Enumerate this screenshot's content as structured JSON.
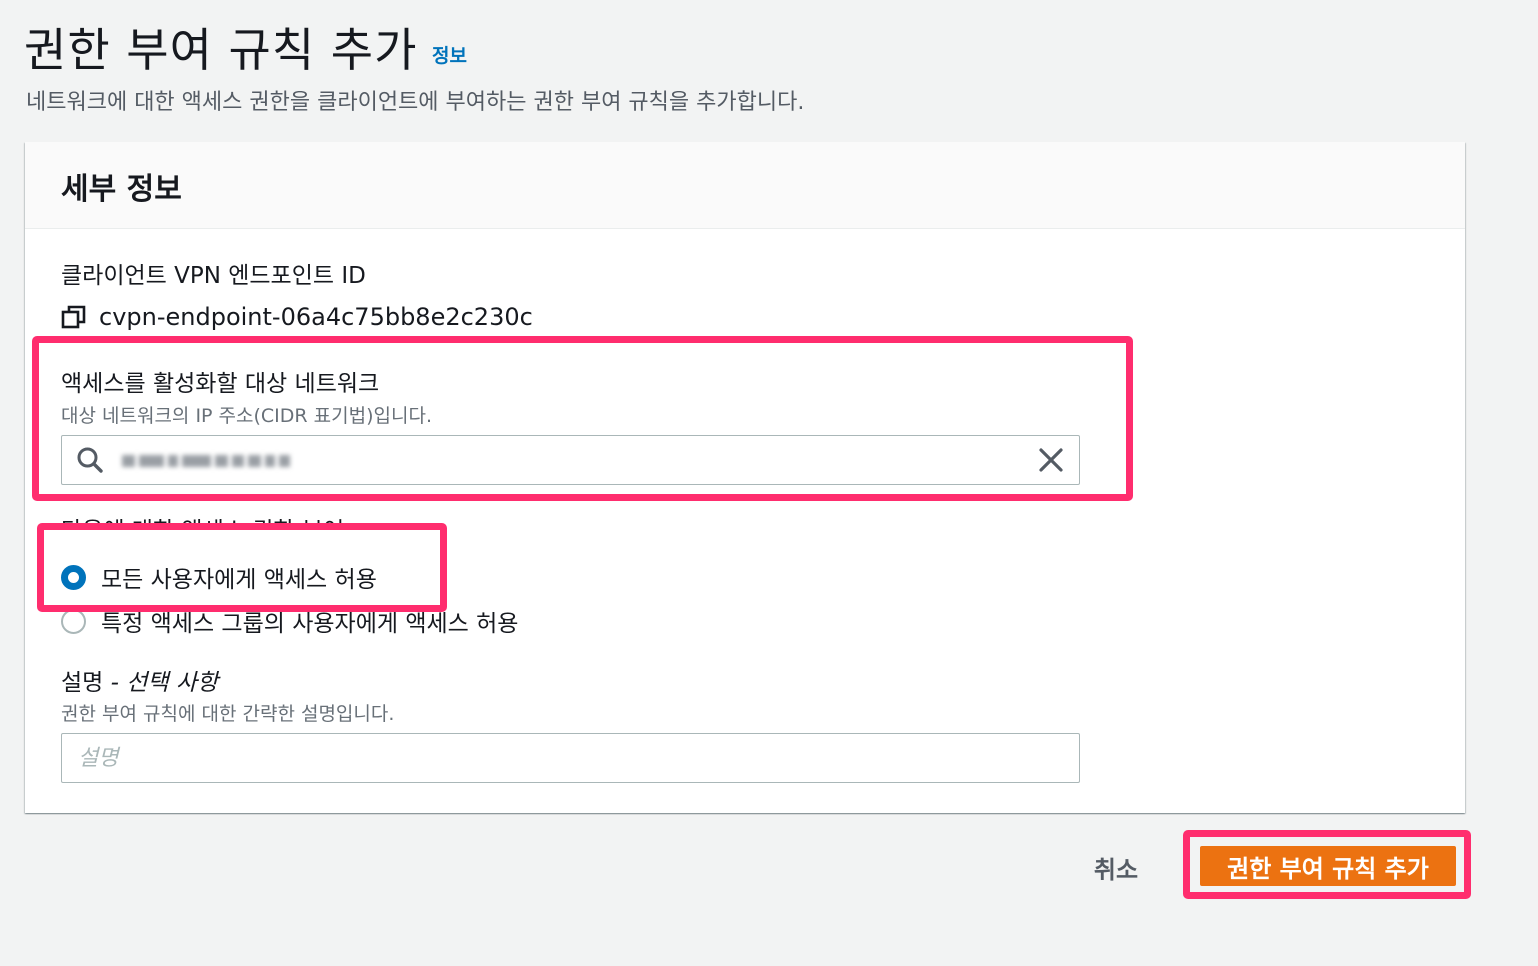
{
  "page": {
    "title": "권한 부여 규칙 추가",
    "info_link": "정보",
    "description": "네트워크에 대한 액세스 권한을 클라이언트에 부여하는 권한 부여 규칙을 추가합니다."
  },
  "panel": {
    "title": "세부 정보",
    "endpoint": {
      "label": "클라이언트 VPN 엔드포인트 ID",
      "value": "cvpn-endpoint-06a4c75bb8e2c230c",
      "icon": "copy-icon"
    },
    "target_network": {
      "label": "액세스를 활성화할 대상 네트워크",
      "hint": "대상 네트워크의 IP 주소(CIDR 표기법)입니다.",
      "value_redacted": true,
      "search_icon": "search-icon",
      "clear_icon": "close-icon"
    },
    "grant_access": {
      "label": "다음에 대한 액세스 권한 부여:",
      "options": [
        {
          "label": "모든 사용자에게 액세스 허용",
          "checked": true
        },
        {
          "label": "특정 액세스 그룹의 사용자에게 액세스 허용",
          "checked": false
        }
      ]
    },
    "description_field": {
      "label": "설명",
      "optional": " - 선택 사항",
      "hint": "권한 부여 규칙에 대한 간략한 설명입니다.",
      "placeholder": "설명",
      "value": ""
    }
  },
  "actions": {
    "cancel_label": "취소",
    "submit_label": "권한 부여 규칙 추가"
  },
  "colors": {
    "primary_button": "#ec7211",
    "link": "#0073bb",
    "radio_checked": "#0073bb",
    "highlight_annotation": "#ff2d6e",
    "background": "#f2f3f3"
  }
}
